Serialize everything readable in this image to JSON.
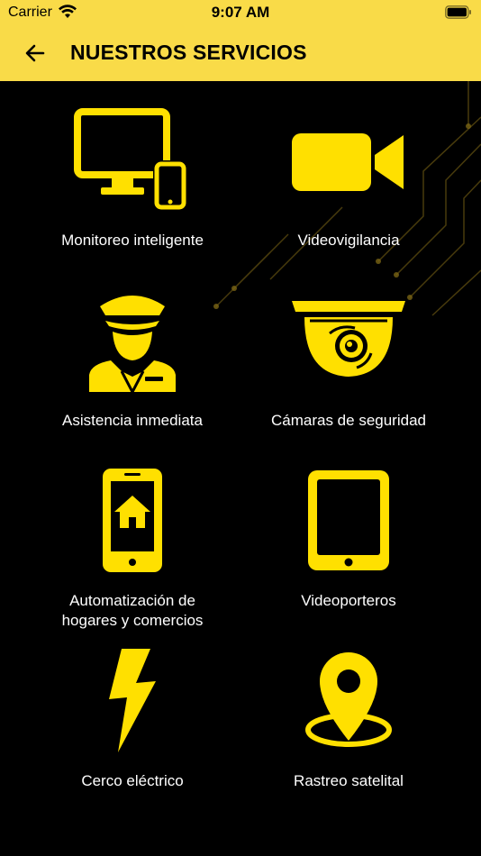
{
  "status_bar": {
    "carrier": "Carrier",
    "time": "9:07 AM",
    "wifi_icon": "wifi-icon",
    "battery_icon": "battery-icon"
  },
  "nav": {
    "back_icon": "arrow-left-icon",
    "title": "NUESTROS SERVICIOS"
  },
  "colors": {
    "accent": "#f9db48",
    "icon_yellow": "#ffe000",
    "background": "#000000",
    "text": "#ffffff"
  },
  "services": [
    {
      "label": "Monitoreo inteligente",
      "icon": "monitor-phone-icon"
    },
    {
      "label": "Videovigilancia",
      "icon": "video-camera-icon"
    },
    {
      "label": "Asistencia inmediata",
      "icon": "security-guard-icon"
    },
    {
      "label": "Cámaras de seguridad",
      "icon": "dome-camera-icon"
    },
    {
      "label": "Automatización de hogares y comercios",
      "icon": "smartphone-home-icon"
    },
    {
      "label": "Videoporteros",
      "icon": "tablet-icon"
    },
    {
      "label": "Cerco eléctrico",
      "icon": "lightning-bolt-icon"
    },
    {
      "label": "Rastreo satelital",
      "icon": "location-pin-icon"
    }
  ]
}
